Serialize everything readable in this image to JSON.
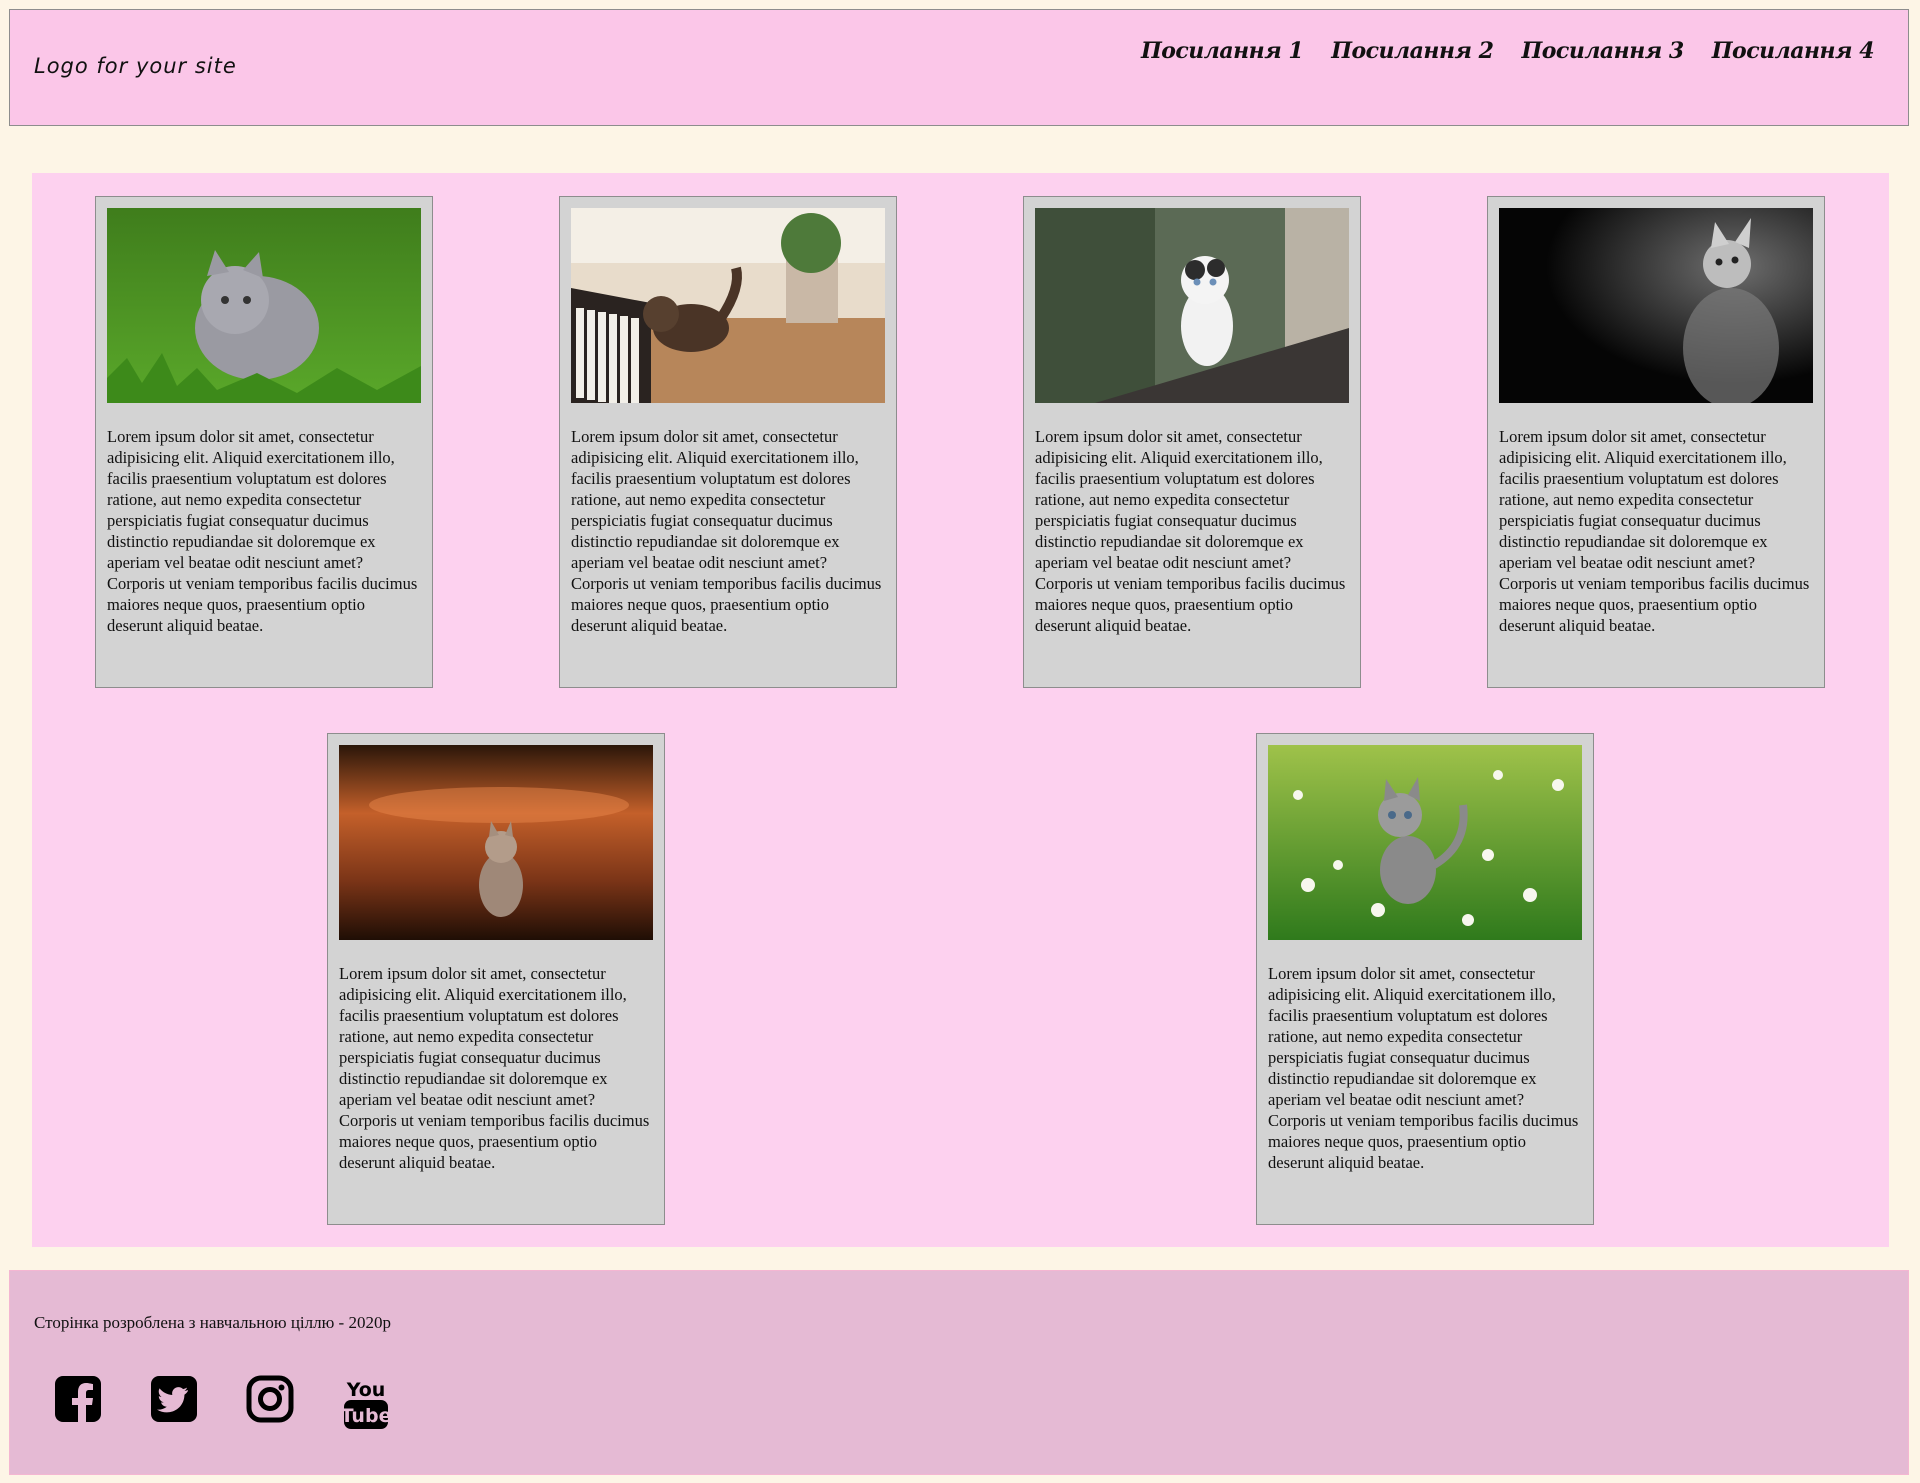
{
  "header": {
    "logo": "Logo for your site",
    "nav": [
      "Посилання 1",
      "Посилання 2",
      "Посилання 3",
      "Посилання 4"
    ]
  },
  "cards": [
    {
      "image": "grey-kitten-on-grass",
      "text": "Lorem ipsum dolor sit amet, consectetur adipisicing elit. Aliquid exercitationem illo, facilis praesentium voluptatum est dolores ratione, aut nemo expedita consectetur perspiciatis fugiat consequatur ducimus distinctio repudiandae sit doloremque ex aperiam vel beatae odit nesciunt amet? Corporis ut veniam temporibus facilis ducimus maiores neque quos, praesentium optio deserunt aliquid beatae."
    },
    {
      "image": "kitten-on-piano",
      "text": "Lorem ipsum dolor sit amet, consectetur adipisicing elit. Aliquid exercitationem illo, facilis praesentium voluptatum est dolores ratione, aut nemo expedita consectetur perspiciatis fugiat consequatur ducimus distinctio repudiandae sit doloremque ex aperiam vel beatae odit nesciunt amet? Corporis ut veniam temporibus facilis ducimus maiores neque quos, praesentium optio deserunt aliquid beatae."
    },
    {
      "image": "white-kitten-on-ledge",
      "text": "Lorem ipsum dolor sit amet, consectetur adipisicing elit. Aliquid exercitationem illo, facilis praesentium voluptatum est dolores ratione, aut nemo expedita consectetur perspiciatis fugiat consequatur ducimus distinctio repudiandae sit doloremque ex aperiam vel beatae odit nesciunt amet? Corporis ut veniam temporibus facilis ducimus maiores neque quos, praesentium optio deserunt aliquid beatae."
    },
    {
      "image": "black-and-white-kitten",
      "text": "Lorem ipsum dolor sit amet, consectetur adipisicing elit. Aliquid exercitationem illo, facilis praesentium voluptatum est dolores ratione, aut nemo expedita consectetur perspiciatis fugiat consequatur ducimus distinctio repudiandae sit doloremque ex aperiam vel beatae odit nesciunt amet? Corporis ut veniam temporibus facilis ducimus maiores neque quos, praesentium optio deserunt aliquid beatae."
    },
    {
      "image": "kitten-in-sunset-light",
      "text": "Lorem ipsum dolor sit amet, consectetur adipisicing elit. Aliquid exercitationem illo, facilis praesentium voluptatum est dolores ratione, aut nemo expedita consectetur perspiciatis fugiat consequatur ducimus distinctio repudiandae sit doloremque ex aperiam vel beatae odit nesciunt amet? Corporis ut veniam temporibus facilis ducimus maiores neque quos, praesentium optio deserunt aliquid beatae."
    },
    {
      "image": "tabby-kitten-in-clover",
      "text": "Lorem ipsum dolor sit amet, consectetur adipisicing elit. Aliquid exercitationem illo, facilis praesentium voluptatum est dolores ratione, aut nemo expedita consectetur perspiciatis fugiat consequatur ducimus distinctio repudiandae sit doloremque ex aperiam vel beatae odit nesciunt amet? Corporis ut veniam temporibus facilis ducimus maiores neque quos, praesentium optio deserunt aliquid beatae."
    }
  ],
  "footer": {
    "note": "Сторінка розроблена з навчальною ціллю - 2020р",
    "socials": [
      "facebook-icon",
      "twitter-icon",
      "instagram-icon",
      "youtube-icon"
    ]
  },
  "colors": {
    "page_background": "#fdf5e6",
    "header_background": "#fbc6e8",
    "content_background": "#fdd1ef",
    "card_background": "#d3d3d3",
    "footer_background": "#e5bad4"
  }
}
